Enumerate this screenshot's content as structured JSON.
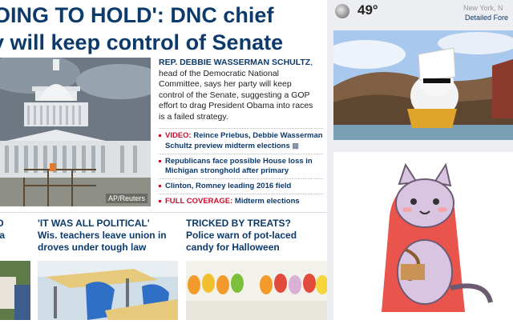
{
  "headline": {
    "line1": "OING TO HOLD': DNC chief",
    "line2": "y will keep control of Senate"
  },
  "lead_photo": {
    "credit": "AP/Reuters"
  },
  "lead": {
    "name": "REP. DEBBIE WASSERMAN SCHULTZ",
    "text": ", head of the Democratic National Committee, says her party will keep control of the Senate, suggesting a GOP effort to drag President Obama into races is a failed strategy."
  },
  "bullets": [
    {
      "prefix": "VIDEO:",
      "text": " Reince Priebus, Debbie Wasserman Schultz preview midterm elections",
      "icon": "video-camera-icon"
    },
    {
      "prefix": "",
      "text": "Republicans face possible House loss in Michigan stronghold after primary"
    },
    {
      "prefix": "",
      "text": "Clinton, Romney leading 2016 field"
    },
    {
      "prefix": "FULL COVERAGE:",
      "text": " Midterm elections"
    }
  ],
  "stories": [
    {
      "kicker": "D",
      "title": "la"
    },
    {
      "kicker": "'IT WAS ALL POLITICAL'",
      "title": "Wis. teachers leave union in droves under tough law"
    },
    {
      "kicker": "TRICKED BY TREATS?",
      "title": "Police warn of pot-laced candy for Halloween"
    }
  ],
  "weather": {
    "temp": "49°",
    "location": "New York, N",
    "forecast_link": "Detailed Fore",
    "icon": "partly-cloudy-icon"
  },
  "colors": {
    "headline": "#0c3a6b",
    "accent_red": "#c8102e"
  }
}
